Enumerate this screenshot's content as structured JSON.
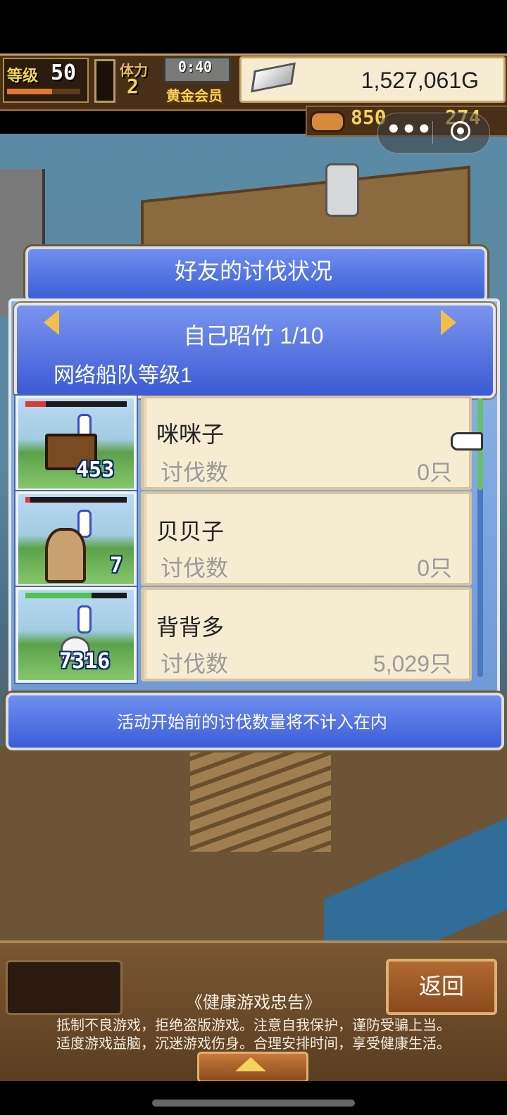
{
  "hud": {
    "level_label": "等级",
    "level_value": "50",
    "level_progress": 0.62,
    "stamina_label": "体力",
    "stamina_value": "2",
    "timer": "0:40",
    "vip": "黄金会员",
    "gold": "1,527,061G",
    "resource1": "850",
    "resource2": "274"
  },
  "dialog": {
    "title": "好友的讨伐状况",
    "friend_name": "自己昭竹 1/10",
    "fleet_level": "网络船队等级1",
    "rows": [
      {
        "name": "咪咪子",
        "label": "讨伐数",
        "value": "0只",
        "count": "453",
        "hp_color": "#d83a3a",
        "hp_fraction": 0.2
      },
      {
        "name": "贝贝子",
        "label": "讨伐数",
        "value": "0只",
        "count": "7",
        "hp_color": "#d83a3a",
        "hp_fraction": 0.05
      },
      {
        "name": "背背多",
        "label": "讨伐数",
        "value": "5,029只",
        "count": "7316",
        "hp_color": "#4fc44f",
        "hp_fraction": 0.65
      }
    ],
    "notice": "活动开始前的讨伐数量将不计入在内"
  },
  "footer": {
    "back_label": "返回",
    "notice_title": "《健康游戏忠告》",
    "notice_line1": "抵制不良游戏，拒绝盗版游戏。注意自我保护，谨防受骗上当。",
    "notice_line2": "适度游戏益脑，沉迷游戏伤身。合理安排时间，享受健康生活。"
  },
  "colors": {
    "accent_blue": "#3b5dd6",
    "gold_text": "#f4d35e",
    "card_bg": "#f6ecd1"
  }
}
